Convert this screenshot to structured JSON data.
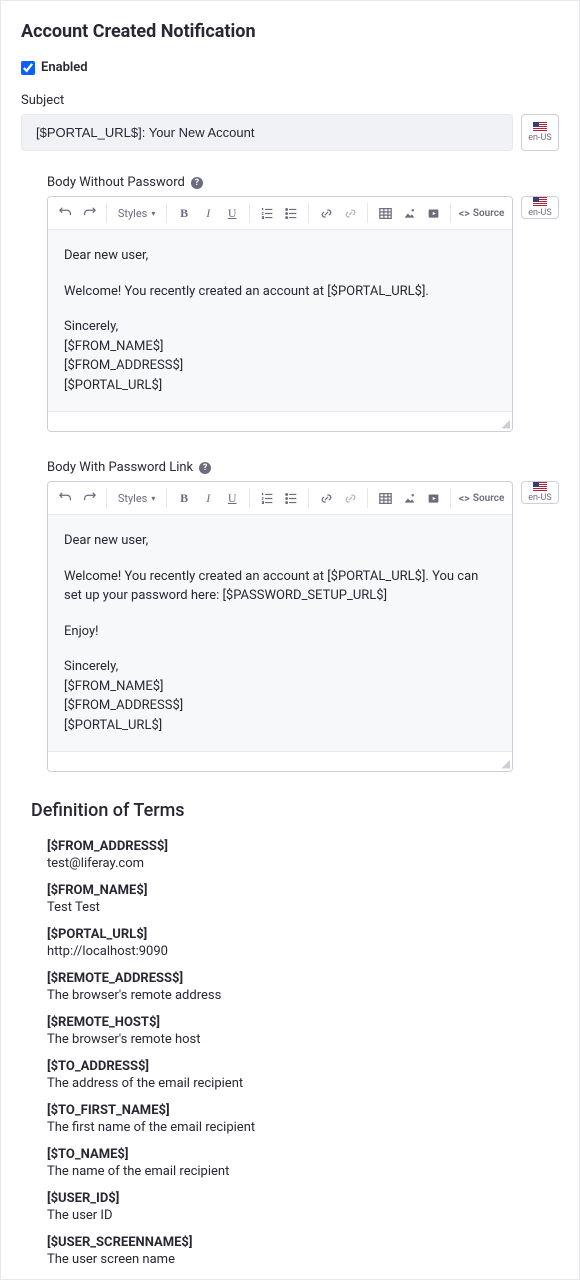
{
  "title": "Account Created Notification",
  "enabled": {
    "label": "Enabled",
    "checked": true
  },
  "subject": {
    "label": "Subject",
    "value": "[$PORTAL_URL$]: Your New Account"
  },
  "locale": {
    "code": "en-US"
  },
  "body_without_password": {
    "label": "Body Without Password",
    "lines": [
      "Dear new user,",
      "",
      "Welcome! You recently created an account at [$PORTAL_URL$].",
      "",
      "Sincerely,",
      "[$FROM_NAME$]",
      "[$FROM_ADDRESS$]",
      "[$PORTAL_URL$]"
    ]
  },
  "body_with_password_link": {
    "label": "Body With Password Link",
    "lines": [
      "Dear new user,",
      "",
      "Welcome! You recently created an account at [$PORTAL_URL$]. You can set up your password here: [$PASSWORD_SETUP_URL$]",
      "",
      "Enjoy!",
      "",
      "Sincerely,",
      "[$FROM_NAME$]",
      "[$FROM_ADDRESS$]",
      "[$PORTAL_URL$]"
    ]
  },
  "toolbar": {
    "styles": "Styles",
    "source": "Source"
  },
  "terms_title": "Definition of Terms",
  "terms": [
    {
      "key": "[$FROM_ADDRESS$]",
      "val": "test@liferay.com"
    },
    {
      "key": "[$FROM_NAME$]",
      "val": "Test Test"
    },
    {
      "key": "[$PORTAL_URL$]",
      "val": "http://localhost:9090"
    },
    {
      "key": "[$REMOTE_ADDRESS$]",
      "val": "The browser's remote address"
    },
    {
      "key": "[$REMOTE_HOST$]",
      "val": "The browser's remote host"
    },
    {
      "key": "[$TO_ADDRESS$]",
      "val": "The address of the email recipient"
    },
    {
      "key": "[$TO_FIRST_NAME$]",
      "val": "The first name of the email recipient"
    },
    {
      "key": "[$TO_NAME$]",
      "val": "The name of the email recipient"
    },
    {
      "key": "[$USER_ID$]",
      "val": "The user ID"
    },
    {
      "key": "[$USER_SCREENNAME$]",
      "val": "The user screen name"
    }
  ]
}
